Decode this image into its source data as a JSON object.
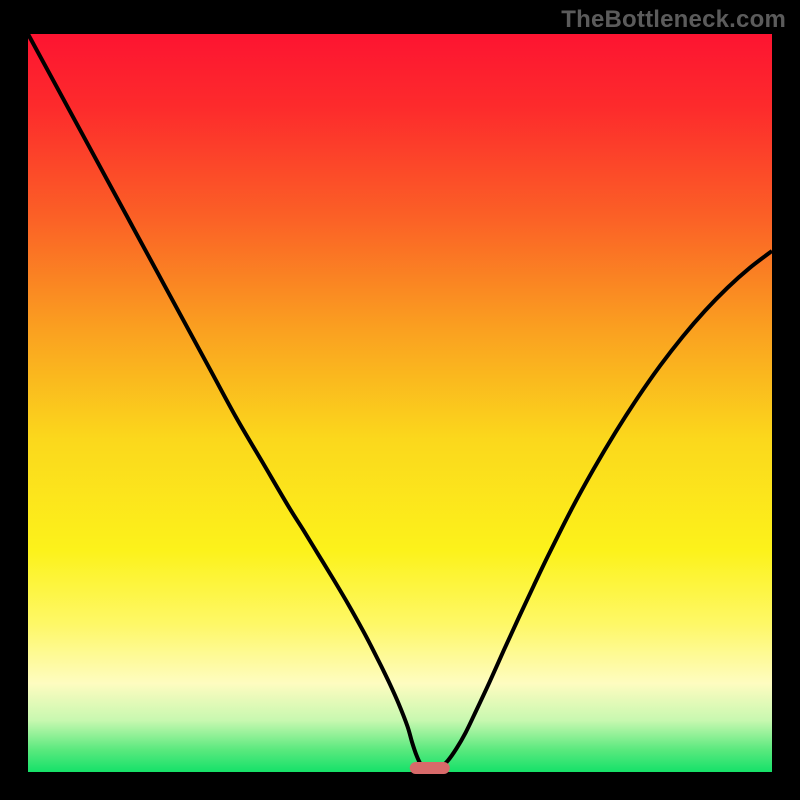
{
  "watermark": {
    "text": "TheBottleneck.com"
  },
  "colors": {
    "frame": "#000000",
    "curve": "#000000",
    "marker": "#d86a6a",
    "gradient_stops": [
      {
        "offset": 0.0,
        "color": "#fd1431"
      },
      {
        "offset": 0.1,
        "color": "#fd2b2c"
      },
      {
        "offset": 0.25,
        "color": "#fb6126"
      },
      {
        "offset": 0.4,
        "color": "#faa020"
      },
      {
        "offset": 0.55,
        "color": "#fbd81c"
      },
      {
        "offset": 0.7,
        "color": "#fcf21b"
      },
      {
        "offset": 0.8,
        "color": "#fef867"
      },
      {
        "offset": 0.88,
        "color": "#fefcc0"
      },
      {
        "offset": 0.93,
        "color": "#c8f8b0"
      },
      {
        "offset": 0.97,
        "color": "#5ae97e"
      },
      {
        "offset": 1.0,
        "color": "#15e169"
      }
    ]
  },
  "chart_data": {
    "type": "line",
    "title": "",
    "xlabel": "",
    "ylabel": "",
    "xlim": [
      0,
      100
    ],
    "ylim": [
      0,
      100
    ],
    "x": [
      0,
      3.5,
      7,
      10.5,
      14,
      17.5,
      21,
      24.5,
      28,
      31.5,
      35,
      37,
      39,
      41,
      43,
      45,
      46.2,
      47.4,
      48.6,
      49.8,
      51,
      51.6,
      52.2,
      52.8,
      53.4,
      54,
      55.2,
      56.4,
      57.6,
      58.8,
      60,
      62,
      64,
      66,
      68,
      70,
      73,
      76,
      79,
      82,
      85,
      88,
      91,
      94,
      97,
      100
    ],
    "values": [
      100,
      93.5,
      87,
      80.5,
      74,
      67.5,
      61,
      54.5,
      48,
      42,
      36,
      32.8,
      29.5,
      26.2,
      22.8,
      19.2,
      16.9,
      14.5,
      12,
      9.3,
      6.2,
      4.1,
      2.3,
      1.0,
      0.3,
      0,
      0.4,
      1.5,
      3.2,
      5.3,
      7.8,
      12.1,
      16.6,
      21.0,
      25.3,
      29.5,
      35.5,
      41.0,
      46.1,
      50.8,
      55.1,
      59.0,
      62.5,
      65.6,
      68.3,
      70.6
    ],
    "optimum_x": 54,
    "annotations": []
  },
  "geometry": {
    "border": 28,
    "top_pad": 34,
    "marker": {
      "w": 40,
      "h": 12,
      "rx": 6
    }
  }
}
